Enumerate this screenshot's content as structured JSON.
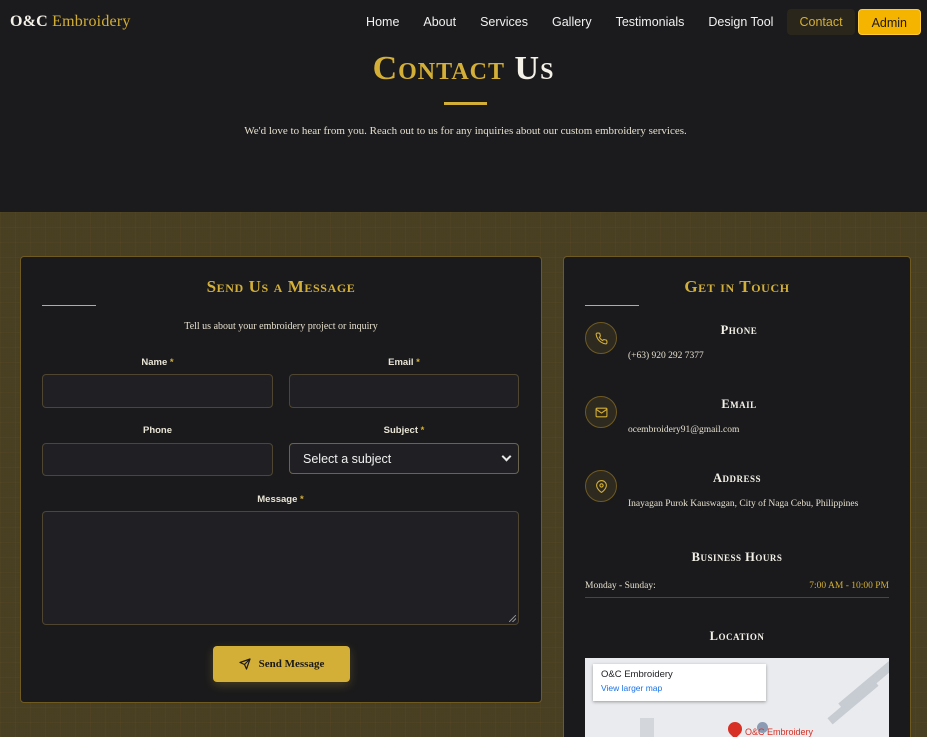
{
  "nav": {
    "brand_main": "O&C",
    "brand_accent": "Embroidery",
    "links": [
      "Home",
      "About",
      "Services",
      "Gallery",
      "Testimonials",
      "Design Tool",
      "Contact",
      "Admin"
    ],
    "active": "Contact"
  },
  "hero": {
    "title_gold": "Contact",
    "title_white": "Us",
    "subtitle": "We'd love to hear from you. Reach out to us for any inquiries about our custom embroidery services."
  },
  "form": {
    "title": "Send Us a Message",
    "intro": "Tell us about your embroidery project or inquiry",
    "name_label": "Name",
    "email_label": "Email",
    "phone_label": "Phone",
    "subject_label": "Subject",
    "subject_value": "Select a subject",
    "message_label": "Message",
    "required_mark": "*",
    "submit_label": "Send Message"
  },
  "info": {
    "title": "Get in Touch",
    "phone_label": "Phone",
    "phone_value": "(+63) 920 292 7377",
    "email_label": "Email",
    "email_value": "ocembroidery91@gmail.com",
    "address_label": "Address",
    "address_value": "Inayagan Purok Kauswagan, City of Naga Cebu, Philippines",
    "hours_title": "Business Hours",
    "hours_day": "Monday - Sunday:",
    "hours_time": "7:00 AM - 10:00 PM",
    "location_title": "Location",
    "map_name": "O&C Embroidery",
    "map_link": "View larger map",
    "map_pin_label": "O&C Embroidery"
  },
  "colors": {
    "gold": "#d4af37",
    "admin_button": "#f5b400",
    "background": "#1b1b1d"
  },
  "icons": [
    "phone-icon",
    "mail-icon",
    "map-pin-icon",
    "send-icon",
    "chevron-down-icon"
  ]
}
